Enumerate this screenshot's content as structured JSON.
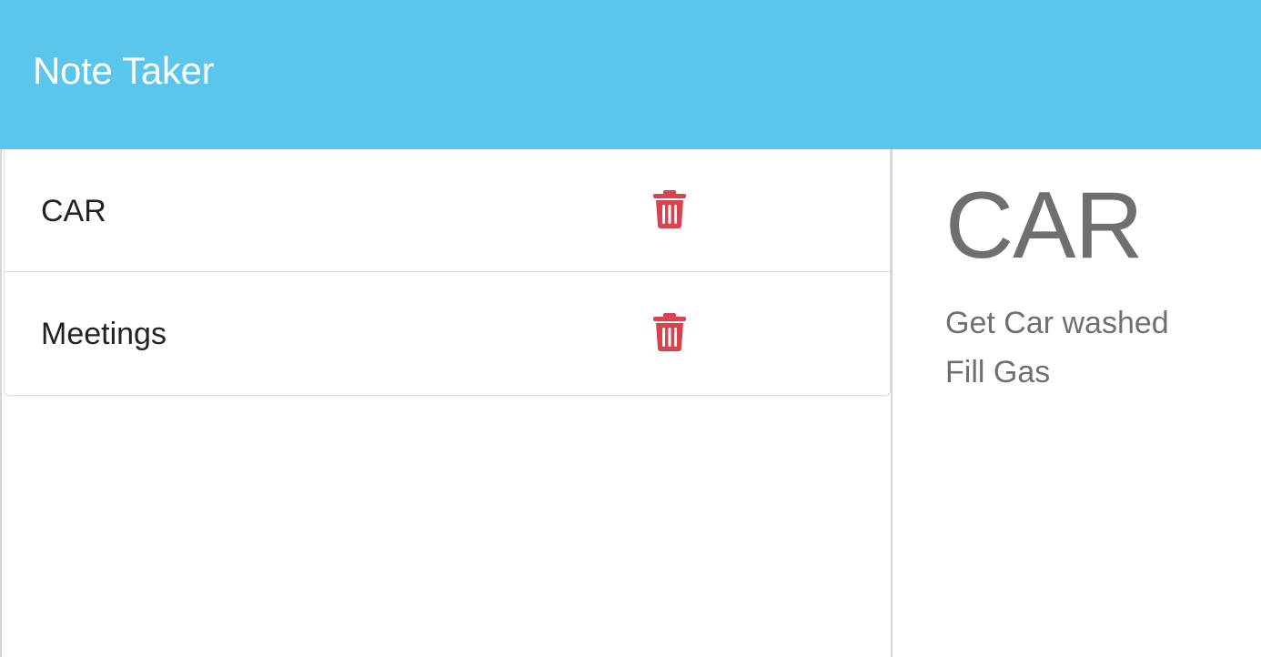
{
  "navbar": {
    "title": "Note Taker"
  },
  "notes": [
    {
      "title": "CAR",
      "delete_icon": "trash-icon"
    },
    {
      "title": "Meetings",
      "delete_icon": "trash-icon"
    }
  ],
  "active_note": {
    "title": "CAR",
    "body_lines": [
      "Get Car washed",
      "Fill Gas"
    ]
  },
  "colors": {
    "navbar_bg": "#5bc6ec",
    "delete_icon": "#d9434f",
    "detail_text": "#6f6f6f"
  }
}
